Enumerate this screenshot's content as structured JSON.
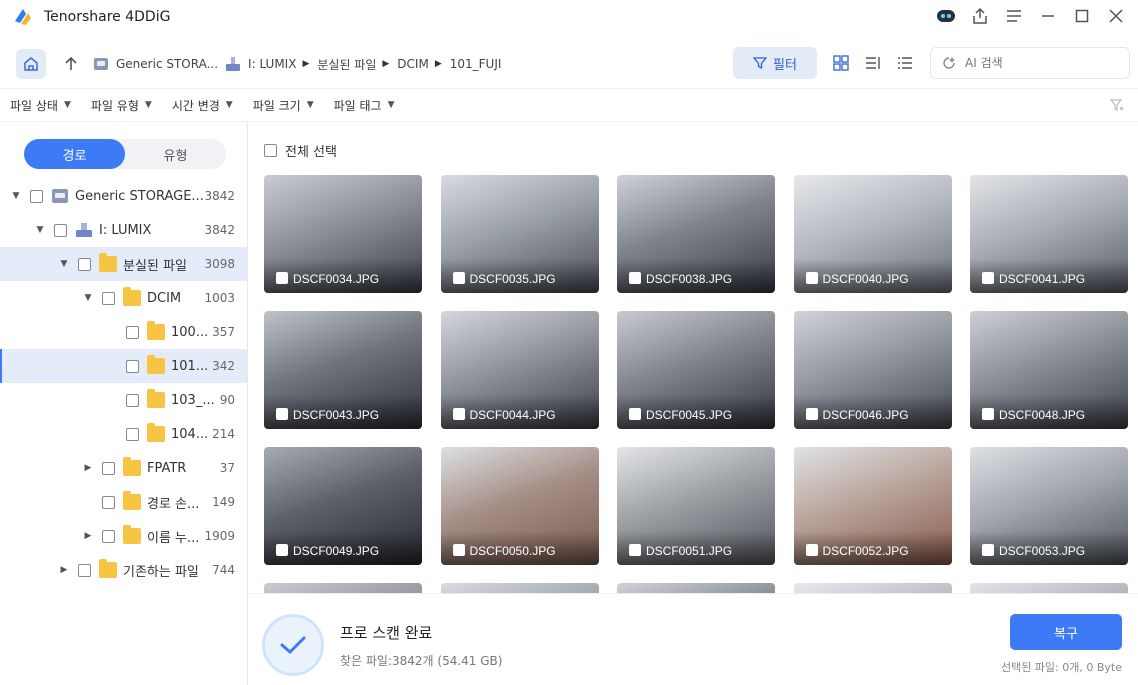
{
  "app": {
    "title": "Tenorshare 4DDiG"
  },
  "nav": {
    "breadcrumbs": [
      {
        "label": "Generic STORA...",
        "icon": "drive-icon"
      },
      {
        "label": "I: LUMIX",
        "icon": "usb-drive-icon"
      },
      {
        "label": "분실된 파일"
      },
      {
        "label": "DCIM"
      },
      {
        "label": "101_FUJI"
      }
    ],
    "filter_label": "필터",
    "search_placeholder": "AI 검색"
  },
  "filters": [
    "파일 상태",
    "파일 유형",
    "시간 변경",
    "파일 크기",
    "파일 태그"
  ],
  "sidebar": {
    "tabs": [
      "경로",
      "유형"
    ],
    "tree": [
      {
        "label": "Generic STORAGE...",
        "count": "3842"
      },
      {
        "label": "I: LUMIX",
        "count": "3842"
      },
      {
        "label": "분실된 파일",
        "count": "3098"
      },
      {
        "label": "DCIM",
        "count": "1003"
      },
      {
        "label": "100...",
        "count": "357"
      },
      {
        "label": "101...",
        "count": "342"
      },
      {
        "label": "103_...",
        "count": "90"
      },
      {
        "label": "104...",
        "count": "214"
      },
      {
        "label": "FPATR",
        "count": "37"
      },
      {
        "label": "경로 손...",
        "count": "149"
      },
      {
        "label": "이름 누...",
        "count": "1909"
      },
      {
        "label": "기존하는 파일",
        "count": "744"
      }
    ]
  },
  "main": {
    "select_all_label": "전체 선택",
    "files": [
      "DSCF0034.JPG",
      "DSCF0035.JPG",
      "DSCF0038.JPG",
      "DSCF0040.JPG",
      "DSCF0041.JPG",
      "DSCF0043.JPG",
      "DSCF0044.JPG",
      "DSCF0045.JPG",
      "DSCF0046.JPG",
      "DSCF0048.JPG",
      "DSCF0049.JPG",
      "DSCF0050.JPG",
      "DSCF0051.JPG",
      "DSCF0052.JPG",
      "DSCF0053.JPG"
    ]
  },
  "bottom": {
    "status_title": "프로 스캔 완료",
    "status_sub": "찾은 파일:3842개 (54.41 GB)",
    "recover_label": "복구",
    "selected_info": "선택된 파일: 0개, 0 Byte"
  },
  "colors": {
    "accent": "#3c7bf5",
    "folder": "#f7c443"
  }
}
